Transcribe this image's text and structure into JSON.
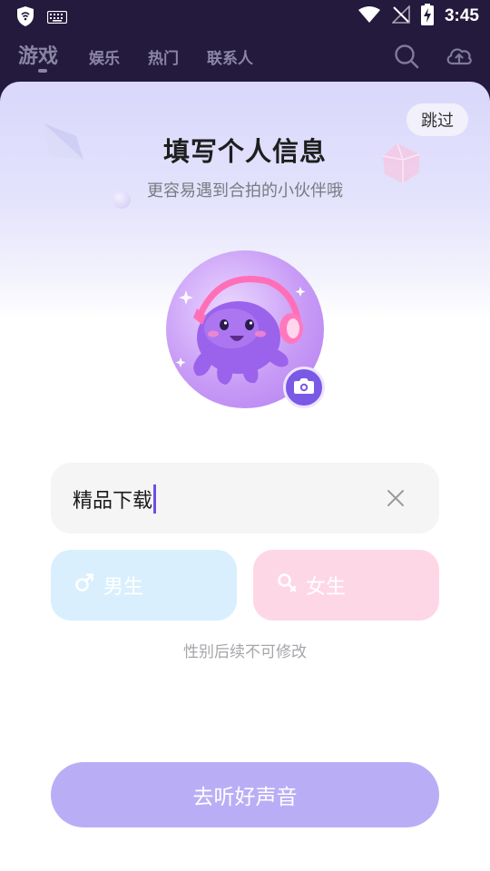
{
  "status_bar": {
    "time": "3:45",
    "icons": [
      "shield-icon",
      "keyboard-icon",
      "wifi-icon",
      "no-signal-icon",
      "battery-charging-icon"
    ]
  },
  "top_nav": {
    "tabs": [
      {
        "label": "游戏",
        "active": true
      },
      {
        "label": "娱乐",
        "active": false
      },
      {
        "label": "热门",
        "active": false
      },
      {
        "label": "联系人",
        "active": false
      }
    ],
    "icons": [
      "search-icon",
      "cloud-upload-icon"
    ]
  },
  "profile": {
    "skip_label": "跳过",
    "title": "填写个人信息",
    "subtitle": "更容易遇到合拍的小伙伴哦",
    "avatar_icon": "octopus-headphones-avatar",
    "camera_icon": "camera-icon",
    "name_value": "精品下载",
    "clear_icon": "close-icon",
    "male_label": "男生",
    "female_label": "女生",
    "gender_note": "性别后续不可修改",
    "cta_label": "去听好声音"
  },
  "colors": {
    "background_dark": "#231a3d",
    "accent": "#7a59e6",
    "cta": "#b9aef6",
    "male": "#d9effd",
    "female": "#fed7e6"
  }
}
